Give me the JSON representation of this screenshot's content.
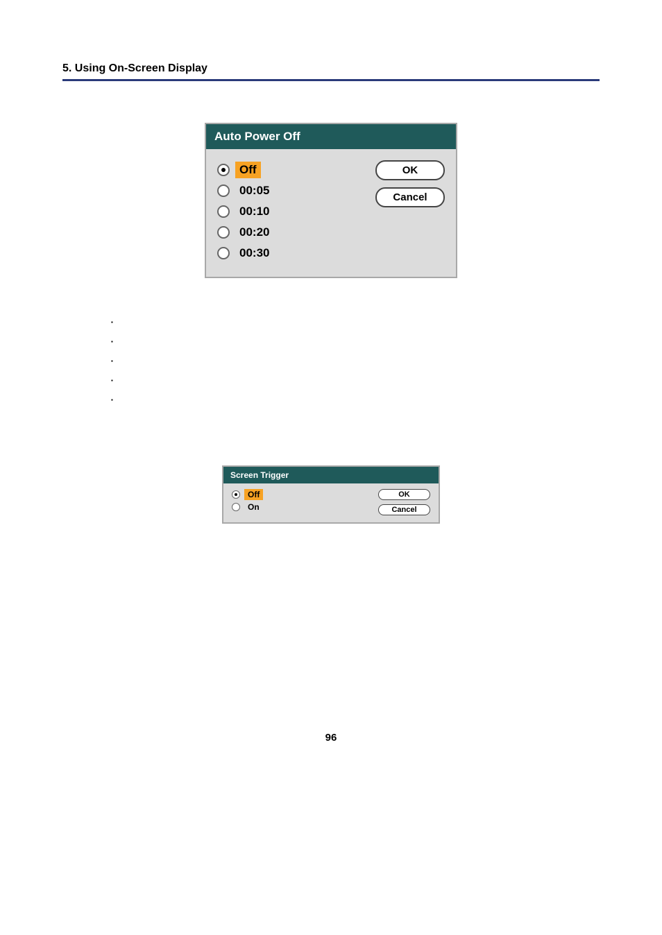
{
  "header": {
    "section_title": "5. Using On-Screen Display"
  },
  "dialog1": {
    "title": "Auto Power Off",
    "options": [
      "Off",
      "00:05",
      "00:10",
      "00:20",
      "00:30"
    ],
    "selected_index": 0,
    "buttons": {
      "ok": "OK",
      "cancel": "Cancel"
    }
  },
  "dialog2": {
    "title": "Screen Trigger",
    "options": [
      "Off",
      "On"
    ],
    "selected_index": 0,
    "buttons": {
      "ok": "OK",
      "cancel": "Cancel"
    }
  },
  "page_number": "96"
}
